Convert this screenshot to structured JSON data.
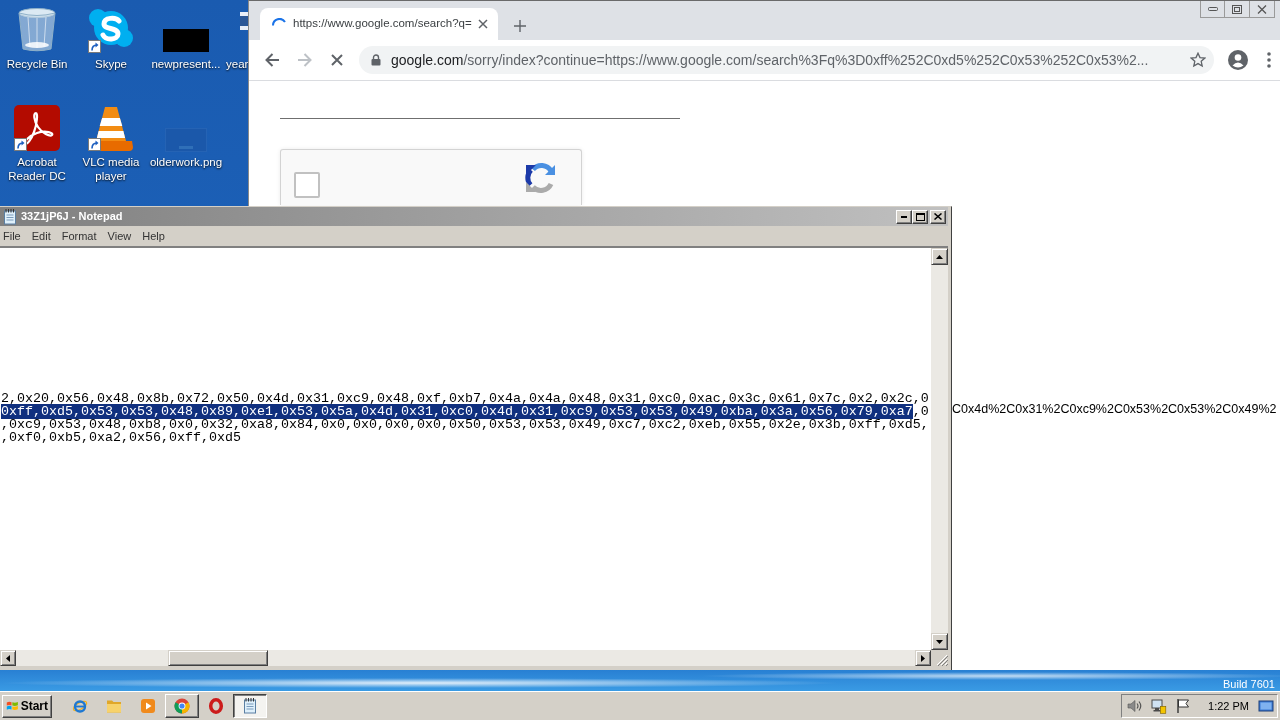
{
  "desktop": {
    "icons": [
      {
        "label": "Recycle Bin",
        "kind": "recycle",
        "shortcut": false
      },
      {
        "label": "Skype",
        "kind": "skype",
        "shortcut": true
      },
      {
        "label": "newpresent...",
        "kind": "dark_file",
        "shortcut": false
      },
      {
        "label": "year",
        "kind": "word",
        "shortcut": false
      },
      {
        "label": "Acrobat Reader DC",
        "kind": "acrobat",
        "shortcut": true
      },
      {
        "label": "VLC media player",
        "kind": "vlc",
        "shortcut": true
      },
      {
        "label": "olderwork.png",
        "kind": "image_file",
        "shortcut": false
      }
    ],
    "build_text": "Build 7601"
  },
  "browser": {
    "tabs": [
      {
        "title": "https://www.google.com/search?q=",
        "loading": true,
        "selected": true
      }
    ],
    "nav": [
      {
        "kind": "back",
        "disabled": false
      },
      {
        "kind": "forward",
        "disabled": true
      },
      {
        "kind": "stop",
        "disabled": false
      }
    ],
    "address": {
      "host": "google.com",
      "rest": "/sorry/index?continue=https://www.google.com/search%3Fq%3D0xff%252C0xd5%252C0x53%252C0x53%2..."
    },
    "bookmarked": false,
    "page": {
      "captcha": {
        "checked": false
      },
      "text_fragment": "C0x4d%2C0x31%2C0xc9%2C0x53%2C0x53%2C0x49%2"
    }
  },
  "notepad": {
    "title": "33Z1jP6J - Notepad",
    "active": false,
    "menu": [
      "File",
      "Edit",
      "Format",
      "View",
      "Help"
    ],
    "lines": [
      {
        "segments": [
          {
            "text": "2,0x20,0x56,0x48,0x8b,0x72,0x50,0x4d,0x31,0xc9,0x48,0xf,0xb7,0x4a,0x4a,0x48,0x31,0xc0,0xac,0x3c,0x61,0x7c,0x2,0x2c,0",
            "selected": false
          }
        ]
      },
      {
        "segments": [
          {
            "text": "0xff,0xd5,0x53,0x53,0x48,0x89,0xe1,0x53,0x5a,0x4d,0x31,0xc0,0x4d,0x31,0xc9,0x53,0x53,0x49,0xba,0x3a,0x56,0x79,0xa7",
            "selected": true
          },
          {
            "text": ",0",
            "selected": false
          }
        ]
      },
      {
        "segments": [
          {
            "text": ",0xc9,0x53,0x48,0xb8,0x0,0x32,0xa8,0x84,0x0,0x0,0x0,0x0,0x50,0x53,0x53,0x49,0xc7,0xc2,0xeb,0x55,0x2e,0x3b,0xff,0xd5,",
            "selected": false
          }
        ]
      },
      {
        "segments": [
          {
            "text": ",0xf0,0xb5,0xa2,0x56,0xff,0xd5",
            "selected": false
          }
        ]
      }
    ]
  },
  "taskbar": {
    "start_label": "Start",
    "items": [
      {
        "kind": "ie",
        "open": false,
        "selected": false
      },
      {
        "kind": "explorer",
        "open": false,
        "selected": false
      },
      {
        "kind": "media_player",
        "open": false,
        "selected": false
      },
      {
        "kind": "chrome",
        "open": true,
        "selected": false
      },
      {
        "kind": "opera",
        "open": false,
        "selected": false
      },
      {
        "kind": "notepad",
        "open": true,
        "selected": true
      }
    ],
    "tray": [
      {
        "kind": "speaker"
      },
      {
        "kind": "network"
      },
      {
        "kind": "action_center"
      }
    ],
    "clock": "1:22 PM"
  }
}
